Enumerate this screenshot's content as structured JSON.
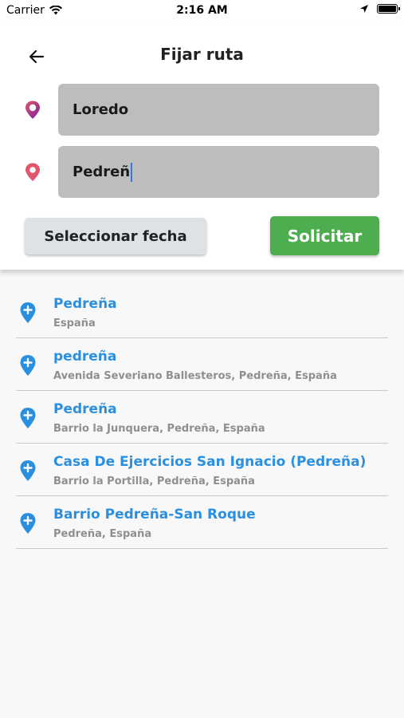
{
  "status": {
    "carrier": "Carrier",
    "time": "2:16 AM"
  },
  "header": {
    "title": "Fijar ruta"
  },
  "route": {
    "origin_value": "Loredo",
    "destination_value": "Pedreñ"
  },
  "actions": {
    "date_label": "Seleccionar fecha",
    "submit_label": "Solicitar"
  },
  "results": [
    {
      "title": "Pedreña",
      "subtitle": "España"
    },
    {
      "title": "pedreña",
      "subtitle": "Avenida Severiano Ballesteros, Pedreña, España"
    },
    {
      "title": "Pedreña",
      "subtitle": "Barrio la Junquera, Pedreña, España"
    },
    {
      "title": "Casa De Ejercicios San Ignacio (Pedreña)",
      "subtitle": "Barrio la Portilla, Pedreña, España"
    },
    {
      "title": "Barrio Pedreña-San Roque",
      "subtitle": "Pedreña, España"
    }
  ],
  "colors": {
    "accent_blue": "#2b8fe0",
    "submit_green": "#4cae4f",
    "origin_icon": "#c2185b",
    "destination_icon": "#e0566b"
  },
  "icons": {
    "back": "arrow-left-icon",
    "origin": "origin-pin-icon",
    "destination": "destination-pin-icon",
    "result": "add-location-icon"
  }
}
